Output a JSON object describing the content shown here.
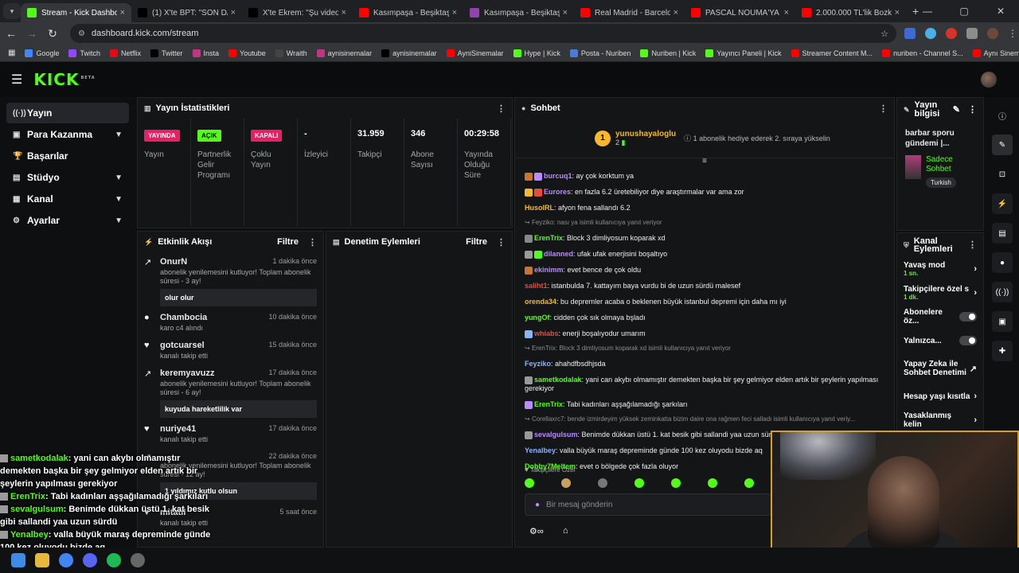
{
  "browser": {
    "tabs": [
      {
        "title": "Stream - Kick Dashboard",
        "color": "#53fc18",
        "active": true
      },
      {
        "title": "(1) X'te BPT: \"SON DAKİKA",
        "color": "#000000"
      },
      {
        "title": "X'te Ekrem: \"Şu videoyu S",
        "color": "#000000"
      },
      {
        "title": "Kasımpaşa - Beşiktaş Maç",
        "color": "#ff0000"
      },
      {
        "title": "Kasımpaşa - Beşiktaş Maç",
        "color": "#8e44ad"
      },
      {
        "title": "Real Madrid - Barcelona",
        "color": "#ff0000"
      },
      {
        "title": "PASCAL NOUMA'YA MEYD",
        "color": "#ff0000"
      },
      {
        "title": "2.000.000 TL'lik Bozkurt",
        "color": "#ff0000"
      }
    ],
    "url": "dashboard.kick.com/stream",
    "bookmarks": [
      "Google",
      "Twitch",
      "Netflix",
      "Twitter",
      "Insta",
      "Youtube",
      "Wraith",
      "aynisinemalar",
      "aynisinemalar",
      "AyniSinemalar",
      "Hype | Kick",
      "Posta - Nuriben",
      "Nuriben | Kick",
      "Yayıncı Paneli | Kick",
      "Streamer Content M...",
      "nuriben - Channel S...",
      "Aynı Sinemalar - Ça..."
    ]
  },
  "header": {
    "logo": "KICK",
    "beta": "BETA"
  },
  "sidebar": {
    "items": [
      {
        "label": "Yayın",
        "icon": "((·))"
      },
      {
        "label": "Para Kazanma",
        "icon": "▣"
      },
      {
        "label": "Başarılar",
        "icon": "🏆"
      },
      {
        "label": "Stüdyo",
        "icon": "▤"
      },
      {
        "label": "Kanal",
        "icon": "▦"
      },
      {
        "label": "Ayarlar",
        "icon": "⚙"
      }
    ]
  },
  "stats": {
    "title": "Yayın İstatistikleri",
    "items": [
      {
        "badge": "YAYINDA",
        "label": "Yayın",
        "badge_bg": "#e91e63",
        "badge_color": "#fff"
      },
      {
        "badge": "AÇIK",
        "label": "Partnerlik Gelir Programı",
        "badge_bg": "#53fc18",
        "badge_color": "#000"
      },
      {
        "badge": "KAPALI",
        "label": "Çoklu Yayın",
        "badge_bg": "#e91e63",
        "badge_color": "#fff"
      },
      {
        "value": "-",
        "label": "İzleyici"
      },
      {
        "value": "31.959",
        "label": "Takipçi"
      },
      {
        "value": "346",
        "label": "Abone Sayısı"
      },
      {
        "value": "00:29:58",
        "label": "Yayında Olduğu Süre"
      }
    ]
  },
  "activity": {
    "title": "Etkinlik Akışı",
    "filter": "Filtre",
    "items": [
      {
        "name": "OnurN",
        "time": "1 dakika önce",
        "desc": "abonelik yenilemesini kutluyor! Toplam abonelik süresi - 3 ay!",
        "msg": "olur olur",
        "icon": "↗"
      },
      {
        "name": "Chambocia",
        "time": "10 dakika önce",
        "desc": "karo c4 alındı",
        "icon": "●"
      },
      {
        "name": "gotcuarsel",
        "time": "15 dakika önce",
        "desc": "kanalı takip etti",
        "icon": "♥"
      },
      {
        "name": "keremyavuzz",
        "time": "17 dakika önce",
        "desc": "abonelik yenilemesini kutluyor! Toplam abonelik süresi - 6 ay!",
        "msg": "kuyuda hareketlilik var",
        "icon": "↗"
      },
      {
        "name": "nuriye41",
        "time": "17 dakika önce",
        "desc": "kanalı takip etti",
        "icon": "♥"
      },
      {
        "name": "",
        "time": "22 dakika önce",
        "desc": "abonelik yenilemesini kutluyor! Toplam abonelik süresi - 12 ay!",
        "msg": "1 yıldımız kutlu olsun",
        "icon": "↗"
      },
      {
        "name": "mitatil",
        "time": "5 saat önce",
        "desc": "kanalı takip etti",
        "icon": "♥"
      }
    ]
  },
  "moderation": {
    "title": "Denetim Eylemleri",
    "filter": "Filtre"
  },
  "chat": {
    "title": "Sohbet",
    "pinned": {
      "coin": "1",
      "name": "yunushayaloglu",
      "sub": "2",
      "text": "1 abonelik hediye ederek 2. sıraya yükselin"
    },
    "messages": [
      {
        "user": "burcuq1",
        "text": "ay çok korktum ya",
        "color": "#b98cff",
        "badges": [
          "#c87533",
          "#b98cff"
        ]
      },
      {
        "user": "Eurores",
        "text": "en fazla 6.2 üretebiliyor diye araştırmalar var ama zor",
        "color": "#b98cff",
        "badges": [
          "#f5b82e",
          "#e74c3c"
        ]
      },
      {
        "user": "HusolRL",
        "text": "afyon fena sallandı 6.2",
        "color": "#f5b82e",
        "badges": []
      },
      {
        "reply": "Feyziko: nası ya isimli kullanıcıya yanıt veriyor"
      },
      {
        "user": "ErenTrix",
        "text": "Block 3 dimliyosum koparak xd",
        "color": "#53fc18",
        "badges": [
          "#888888"
        ]
      },
      {
        "user": "dilanned",
        "text": "ufak ufak enerjisini boşaltıyo",
        "color": "#b98cff",
        "badges": [
          "#999999",
          "#53fc18"
        ]
      },
      {
        "user": "ekinimm",
        "text": "evet bence de çok oldu",
        "color": "#b98cff",
        "badges": [
          "#c87533"
        ]
      },
      {
        "user": "saliht1",
        "text": "istanbulda 7. kattayım baya vurdu bi de uzun sürdü malesef",
        "color": "#e74c3c",
        "badges": []
      },
      {
        "user": "orenda34",
        "text": "bu depremler acaba o beklenen büyük istanbul depremi için daha mı iyi",
        "color": "#f5b82e",
        "badges": []
      },
      {
        "user": "yungOf",
        "text": "cidden çok sık olmaya bşladı",
        "color": "#53fc18",
        "badges": []
      },
      {
        "user": "whiabs",
        "text": "enerji boşalıyodur umarım",
        "color": "#e74c3c",
        "badges": [
          "#8ab4f8"
        ]
      },
      {
        "reply": "ErenTrix: Block 3 dimliyosum koparak xd isimli kullanıcıya yanıt veriyor"
      },
      {
        "user": "Feyziko",
        "text": "ahahdfbsdhjsda",
        "color": "#8ab4f8",
        "badges": []
      },
      {
        "user": "sametkodalak",
        "text": "yani can akybı olmamıştır demekten başka bir şey gelmiyor elden artık bir şeylerin yapılması gerekiyor",
        "color": "#53fc18",
        "badges": [
          "#999999"
        ]
      },
      {
        "user": "ErenTrix",
        "text": "Tabi kadınları aşşağılamadığı şarkıları",
        "color": "#53fc18",
        "badges": [
          "#b98cff"
        ]
      },
      {
        "reply": "Corellaxrc7: bende izmirdeyim yüksek zeminkatta bizim daire ona rağmen feci salladı isimli kullanıcıya yanıt veriy..."
      },
      {
        "user": "sevalgulsum",
        "text": "Benimde dükkan üstü 1. kat besik gibi sallandi yaa uzun sürdü",
        "color": "#b98cff",
        "badges": [
          "#999999"
        ]
      },
      {
        "user": "Yenalbey",
        "text": "valla büyük maraş depreminde günde 100 kez oluyodu bizde aq",
        "color": "#8ab4f8",
        "badges": []
      },
      {
        "user": "Dobby7Meltem",
        "text": "evet o bölgede çok fazla oluyor",
        "color": "#53fc18",
        "badges": []
      }
    ],
    "followers_only": "Takipçilere Özel",
    "input_placeholder": "Bir mesaj gönderin"
  },
  "stream_info": {
    "title": "Yayın bilgisi",
    "stream_title": "barbar sporu gündemi |...",
    "category": "Sadece Sohbet",
    "tag": "Turkish"
  },
  "channel_actions": {
    "title": "Kanal Eylemleri",
    "items": [
      {
        "label": "Yavaş mod",
        "sub": "1 sn.",
        "type": "arrow"
      },
      {
        "label": "Takipçilere özel s",
        "sub": "1 dk.",
        "type": "arrow"
      },
      {
        "label": "Abonelere öz...",
        "sub": "",
        "type": "toggle"
      },
      {
        "label": "Yalnızca...",
        "sub": "",
        "type": "toggle"
      },
      {
        "label": "Yapay Zeka ile Sohbet Denetimi",
        "sub": "",
        "type": "ext"
      },
      {
        "label": "Hesap yaşı kısıtla",
        "sub": "",
        "type": "arrow"
      },
      {
        "label": "Yasaklanmış kelin",
        "sub": "",
        "type": "arrow"
      }
    ]
  },
  "overlay": {
    "lines": [
      {
        "user": "sametkodalak",
        "text": ": yani can akybı olmamıştır demekten başka bir şey gelmiyor elden artık bir şeylerin yapılması gerekiyor"
      },
      {
        "user": "ErenTrix",
        "text": ": Tabi kadınları aşşağılamadığı şarkıları"
      },
      {
        "user": "sevalgulsum",
        "text": ": Benimde dükkan üstü 1. kat besik gibi sallandi yaa uzun sürdü"
      },
      {
        "user": "Yenalbey",
        "text": ": valla büyük maraş depreminde günde 100 kez oluyodu bizde aq"
      },
      {
        "user": "",
        "text": "de çok fazla oluyor"
      }
    ]
  }
}
